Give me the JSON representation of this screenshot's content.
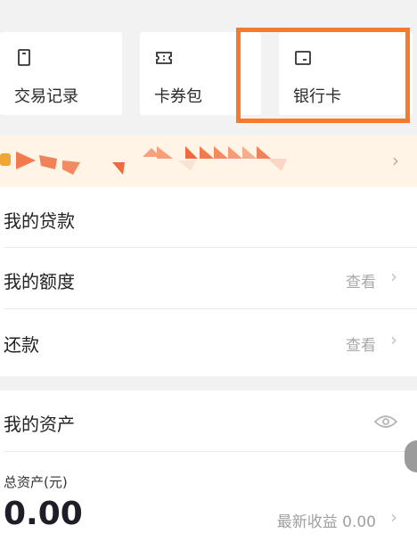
{
  "cards": {
    "transactions": {
      "label": "交易记录",
      "icon": "receipt-icon"
    },
    "coupons": {
      "label": "卡券包",
      "icon": "ticket-icon"
    },
    "bankcard": {
      "label": "银行卡",
      "icon": "card-icon"
    }
  },
  "colors": {
    "highlight": "#f57a2c",
    "banner_bg": "#fff4e6"
  },
  "loans": {
    "title": "我的贷款",
    "quota": {
      "label": "我的额度",
      "action": "查看"
    },
    "repay": {
      "label": "还款",
      "action": "查看"
    }
  },
  "assets": {
    "title": "我的资产",
    "total_label": "总资产(元)",
    "total_value": "0.00",
    "earnings": "最新收益 0.00"
  }
}
